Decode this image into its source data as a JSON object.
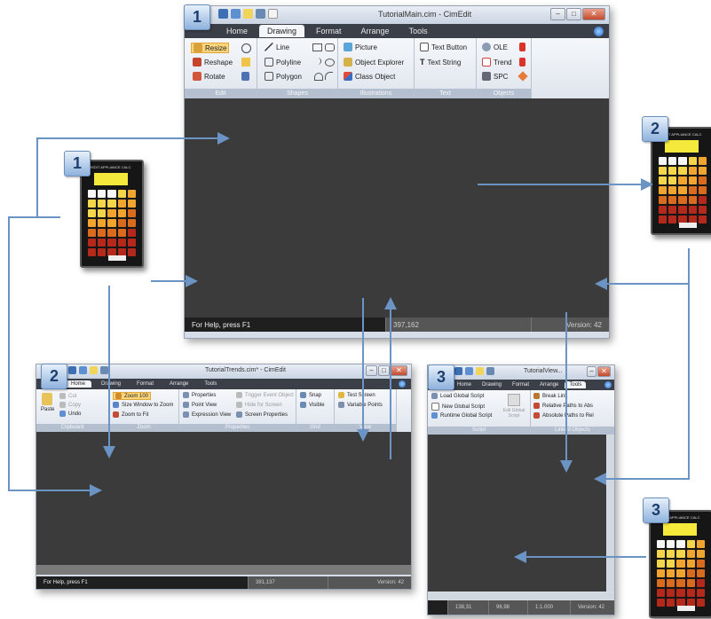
{
  "badges": {
    "one": "1",
    "two": "2",
    "three": "3"
  },
  "main_window": {
    "title": "TutorialMain.cim - CimEdit",
    "tabs": [
      "Home",
      "Drawing",
      "Format",
      "Arrange",
      "Tools"
    ],
    "active_tab": "Drawing",
    "groups": {
      "edit": {
        "label": "Edit",
        "items": [
          "Resize",
          "Reshape",
          "Rotate"
        ]
      },
      "shapes": {
        "label": "Shapes",
        "items": [
          "Line",
          "Polyline",
          "Polygon"
        ]
      },
      "illustrations": {
        "label": "Illustrations",
        "items": [
          "Picture",
          "Object Explorer",
          "Class Object"
        ]
      },
      "text": {
        "label": "Text",
        "items": [
          "Text Button",
          "Text String"
        ]
      },
      "objects": {
        "label": "Objects",
        "items": [
          "OLE",
          "Trend",
          "SPC"
        ]
      }
    },
    "status": {
      "help": "For Help, press F1",
      "coords": "397,162",
      "version": "Version: 42"
    }
  },
  "window2": {
    "title": "TutorialTrends.cim* - CimEdit",
    "tabs": [
      "Home",
      "Drawing",
      "Format",
      "Arrange",
      "Tools"
    ],
    "active_tab": "Home",
    "groups": {
      "clipboard": {
        "label": "Clipboard",
        "items": [
          "Paste",
          "Cut",
          "Copy",
          "Undo"
        ]
      },
      "zoom": {
        "label": "Zoom",
        "items": [
          "Zoom 100",
          "Size Window to Zoom",
          "Zoom to Fit"
        ]
      },
      "properties": {
        "label": "Properties",
        "items": [
          "Properties",
          "Point View",
          "Expression View",
          "Trigger Event Object",
          "Hide for Screen",
          "Screen Properties"
        ]
      },
      "grid": {
        "label": "Grid",
        "items": [
          "Snap",
          "Visible"
        ]
      },
      "view": {
        "label": "View",
        "items": [
          "Test Screen",
          "Variable Points"
        ]
      }
    },
    "status": {
      "help": "For Help, press F1",
      "coords": "381,137",
      "version": "Version: 42"
    }
  },
  "window3": {
    "title": "TutorialView...",
    "tabs": [
      "Home",
      "Drawing",
      "Format",
      "Arrange",
      "Tools"
    ],
    "active_tab": "Tools",
    "groups": {
      "script": {
        "label": "Script",
        "items": [
          "Load Global Script",
          "New Global Script",
          "Runtime Global Script",
          "Edit Global Script"
        ]
      },
      "linked": {
        "label": "Linked Objects",
        "items": [
          "Break Link",
          "Relative Paths to Abs",
          "Absolute Paths to Rel"
        ]
      }
    },
    "status": {
      "coords_a": "138,31",
      "coords_b": "96,98",
      "zoom": "1:1.000",
      "version": "Version: 42"
    }
  },
  "calculator": {
    "header": "CIMEDIT APPLIANCE CALC",
    "key_colors": [
      "#f7f7f7",
      "#f5d64a",
      "#f2a52e",
      "#d96b1e",
      "#b5281c"
    ]
  },
  "colors": {
    "canvas": "#3b3b3b",
    "arrow": "#6b93c4",
    "status_bar": "#1f1f1f"
  }
}
